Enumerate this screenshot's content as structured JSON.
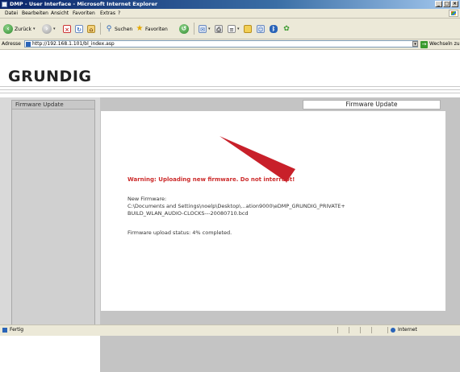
{
  "window": {
    "title": "DMP - User Interface - Microsoft Internet Explorer",
    "controls": [
      "_",
      "□",
      "×"
    ]
  },
  "menu": [
    "Datei",
    "Bearbeiten",
    "Ansicht",
    "Favoriten",
    "Extras",
    "?"
  ],
  "toolbar": {
    "back_label": "Zurück",
    "search_label": "Suchen",
    "favorites_label": "Favoriten"
  },
  "address": {
    "label": "Adresse",
    "url": "http://192.168.1.101/bl_index.asp",
    "go_label": "Wechseln zu"
  },
  "page": {
    "logo": "GRUNDIG",
    "sidebar_tab": "Firmware Update",
    "content_tab": "Firmware Update",
    "warning": "Warning: Uploading new firmware. Do not interrupt!",
    "new_firmware_label": "New Firmware:",
    "firmware_path_line1": "C:\\Documents and Settings\\noelp\\Desktop\\...ation9000\\eDMP_GRUNDIG_PRIVATE+",
    "firmware_path_line2": "BUILD_WLAN_AUDIO-CLOCKS---20080710.bcd",
    "upload_status": "Firmware upload status: 4% completed.",
    "upload_progress_percent": 4
  },
  "statusbar": {
    "text": "Fertig",
    "zone": "Internet"
  },
  "colors": {
    "warning": "#cc2b2b",
    "arrow": "#c8202a",
    "title_bar": "#0a246a"
  }
}
